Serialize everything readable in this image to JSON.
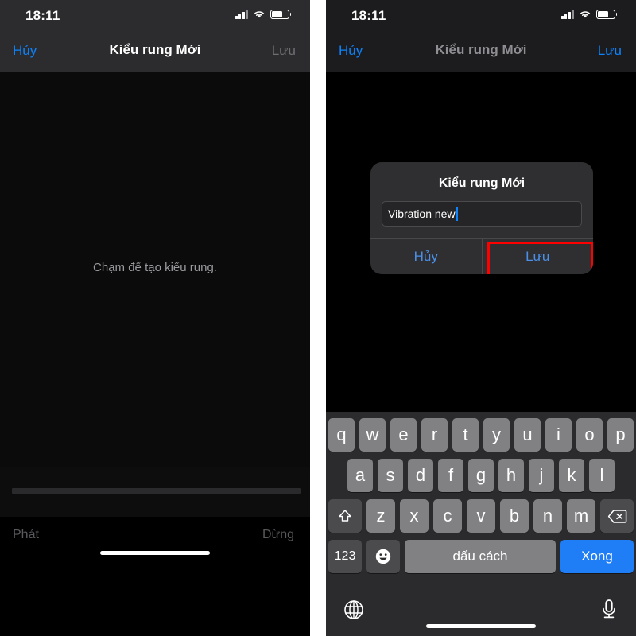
{
  "meta": {
    "accent_blue": "#0a84ff",
    "annotation_red": "#ff0000",
    "done_key_blue": "#1f7ef5"
  },
  "left_phone": {
    "status_bar": {
      "time": "18:11",
      "cellular_icon": "signal-bars-icon",
      "wifi_icon": "wifi-icon",
      "battery_icon": "battery-icon"
    },
    "nav_bar": {
      "cancel_label": "Hủy",
      "title": "Kiểu rung Mới",
      "save_label": "Lưu",
      "save_enabled": false
    },
    "canvas": {
      "hint": "Chạm để tạo kiểu rung."
    },
    "transport": {
      "play_label": "Phát",
      "stop_label": "Dừng"
    }
  },
  "right_phone": {
    "status_bar": {
      "time": "18:11",
      "cellular_icon": "signal-bars-icon",
      "wifi_icon": "wifi-icon",
      "battery_icon": "battery-icon"
    },
    "nav_bar": {
      "cancel_label": "Hủy",
      "title": "Kiểu rung Mới",
      "save_label": "Lưu",
      "save_enabled": true
    },
    "dialog": {
      "title": "Kiểu rung Mới",
      "input_value": "Vibration new",
      "input_placeholder": "",
      "cancel_label": "Hủy",
      "save_label": "Lưu",
      "highlighted_button": "Lưu"
    },
    "keyboard": {
      "row1": [
        "q",
        "w",
        "e",
        "r",
        "t",
        "y",
        "u",
        "i",
        "o",
        "p"
      ],
      "row2": [
        "a",
        "s",
        "d",
        "f",
        "g",
        "h",
        "j",
        "k",
        "l"
      ],
      "row3": [
        "z",
        "x",
        "c",
        "v",
        "b",
        "n",
        "m"
      ],
      "shift_icon": "shift-icon",
      "backspace_icon": "backspace-icon",
      "numbers_label": "123",
      "emoji_icon": "emoji-icon",
      "space_label": "dấu cách",
      "done_label": "Xong",
      "globe_icon": "globe-icon",
      "mic_icon": "microphone-icon"
    }
  }
}
